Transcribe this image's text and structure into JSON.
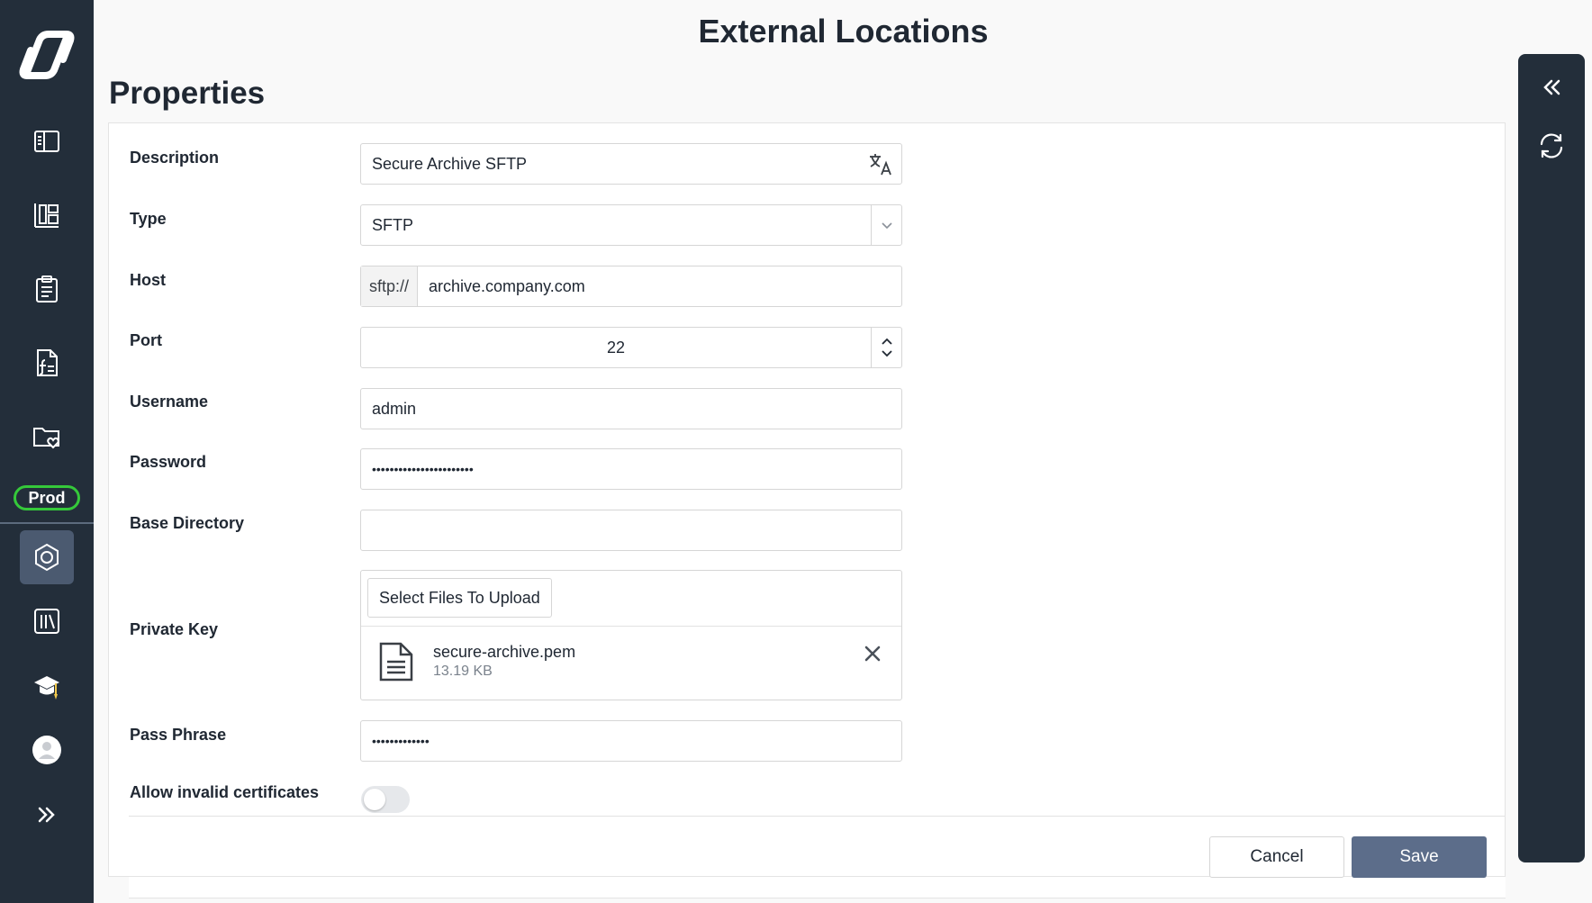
{
  "header": {
    "page_title": "External Locations",
    "section_title": "Properties"
  },
  "nav": {
    "env_badge": "Prod",
    "items": [
      {
        "icon": "book-open-icon"
      },
      {
        "icon": "dashboard-icon"
      },
      {
        "icon": "clipboard-list-icon"
      },
      {
        "icon": "document-function-icon"
      },
      {
        "icon": "folder-heart-icon"
      },
      {
        "icon": "hexagon-settings-icon",
        "active": true
      },
      {
        "icon": "library-icon"
      },
      {
        "icon": "graduation-cap-icon"
      },
      {
        "icon": "user-avatar-icon"
      },
      {
        "icon": "expand-double-chevron-icon"
      }
    ]
  },
  "rail": {
    "items": [
      {
        "icon": "collapse-double-chevron-icon"
      },
      {
        "icon": "refresh-icon"
      }
    ]
  },
  "form": {
    "description": {
      "label": "Description",
      "value": "Secure Archive SFTP"
    },
    "type": {
      "label": "Type",
      "value": "SFTP"
    },
    "host": {
      "label": "Host",
      "prefix": "sftp://",
      "value": "archive.company.com"
    },
    "port": {
      "label": "Port",
      "value": "22"
    },
    "username": {
      "label": "Username",
      "value": "admin"
    },
    "password": {
      "label": "Password",
      "value": "•••••••••••••••••••••••"
    },
    "base_directory": {
      "label": "Base Directory",
      "value": ""
    },
    "private_key": {
      "label": "Private Key",
      "upload_label": "Select Files To Upload",
      "file_name": "secure-archive.pem",
      "file_size": "13.19 KB"
    },
    "pass_phrase": {
      "label": "Pass Phrase",
      "value": "•••••••••••••"
    },
    "allow_invalid_certificates": {
      "label": "Allow invalid certificates",
      "enabled": false
    }
  },
  "actions": {
    "cancel_label": "Cancel",
    "save_label": "Save"
  },
  "colors": {
    "nav_bg": "#232e3a",
    "active_item": "#4b5a70",
    "badge_border": "#35c93a",
    "save_bg": "#5c6d8a"
  }
}
